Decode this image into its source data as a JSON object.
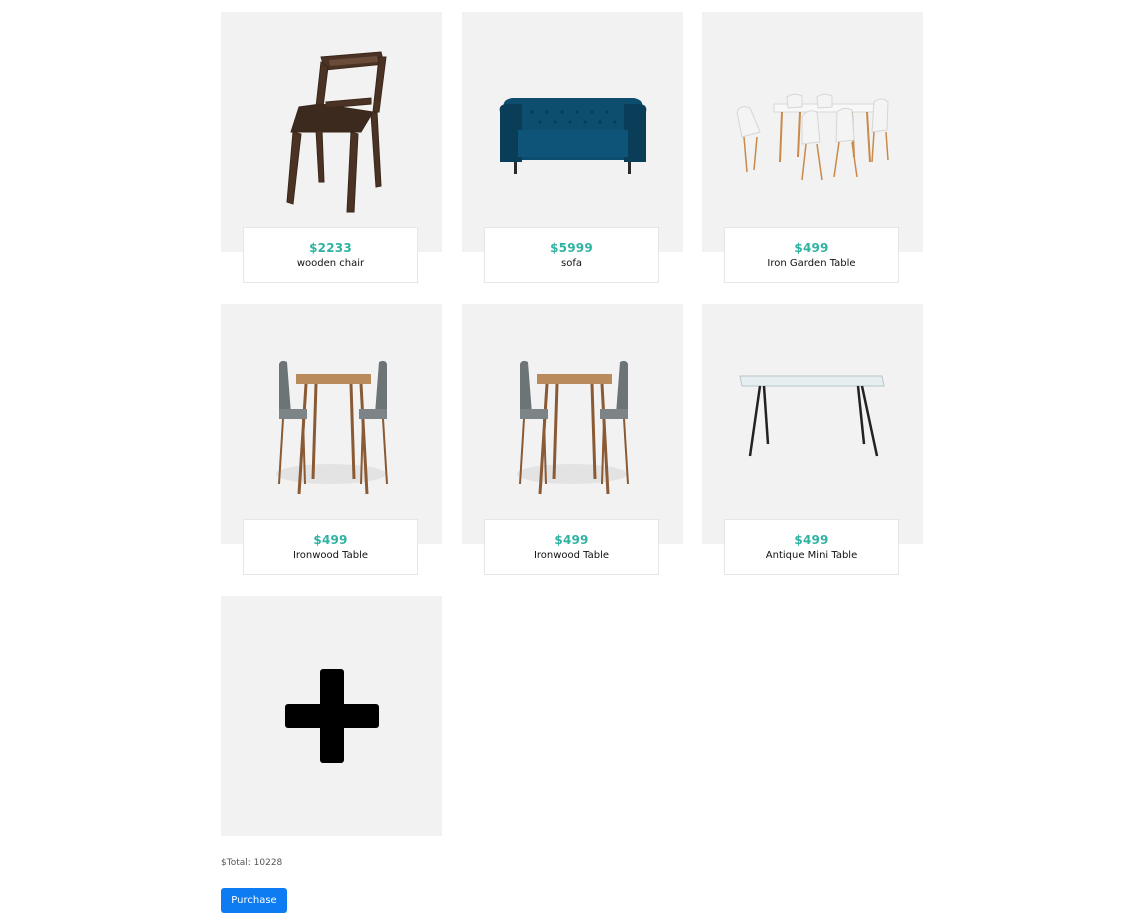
{
  "products": [
    {
      "price": "$2233",
      "name": "wooden chair",
      "icon": "wooden-chair-image"
    },
    {
      "price": "$5999",
      "name": "sofa",
      "icon": "sofa-image"
    },
    {
      "price": "$499",
      "name": "Iron Garden Table",
      "icon": "garden-table-set-image"
    },
    {
      "price": "$499",
      "name": "Ironwood Table",
      "icon": "bar-table-set-image"
    },
    {
      "price": "$499",
      "name": "Ironwood Table",
      "icon": "bar-table-set-image"
    },
    {
      "price": "$499",
      "name": "Antique Mini Table",
      "icon": "glass-table-image"
    }
  ],
  "add_card": {
    "icon": "plus-icon"
  },
  "footer": {
    "total_label": "$Total: 10228",
    "purchase_label": "Purchase"
  },
  "colors": {
    "card_bg": "#f2f2f2",
    "price": "#2eb3a3",
    "button": "#0d7cf2"
  }
}
